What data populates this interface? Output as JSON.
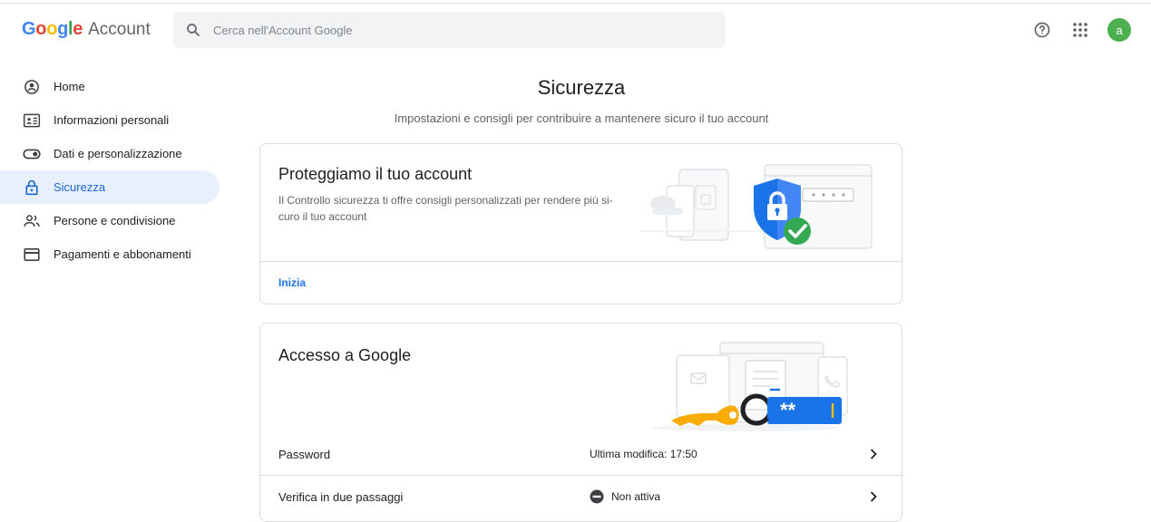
{
  "header": {
    "brand": {
      "G": "G",
      "o1": "o",
      "o2": "o",
      "g": "g",
      "l": "l",
      "e": "e",
      "account": "Account"
    },
    "search_placeholder": "Cerca nell'Account Google",
    "avatar_letter": "a"
  },
  "colors": {
    "blue": "#4285f4",
    "red": "#ea4335",
    "yellow": "#fbbc04",
    "green": "#34a853",
    "active_bg": "#e8f0fe",
    "active_text": "#1967d2",
    "link": "#1a73e8"
  },
  "sidebar": {
    "items": [
      {
        "label": "Home",
        "icon": "home-circle-icon"
      },
      {
        "label": "Informazioni personali",
        "icon": "id-card-icon"
      },
      {
        "label": "Dati e personalizzazione",
        "icon": "toggle-icon"
      },
      {
        "label": "Sicurezza",
        "icon": "lock-icon",
        "active": true
      },
      {
        "label": "Persone e condivisione",
        "icon": "people-icon"
      },
      {
        "label": "Pagamenti e abbonamenti",
        "icon": "credit-card-icon"
      }
    ]
  },
  "main": {
    "title": "Sicurezza",
    "subtitle": "Impostazioni e consigli per contribuire a mantenere sicuro il tuo account",
    "protect_card": {
      "title": "Proteggiamo il tuo account",
      "description": "Il Controllo sicurezza ti offre consigli personalizzati per rendere più si-curo il tuo account",
      "desc_line1": "Il Controllo sicurezza ti offre consigli personalizzati per rendere più si-",
      "desc_line2": "curo il tuo account",
      "action": "Inizia"
    },
    "signin_card": {
      "title": "Accesso a Google",
      "password_mask": "**",
      "rows": [
        {
          "label": "Password",
          "value": "Ultima modifica: 17:50"
        },
        {
          "label": "Verifica in due passaggi",
          "value": "Non attiva"
        }
      ]
    }
  }
}
